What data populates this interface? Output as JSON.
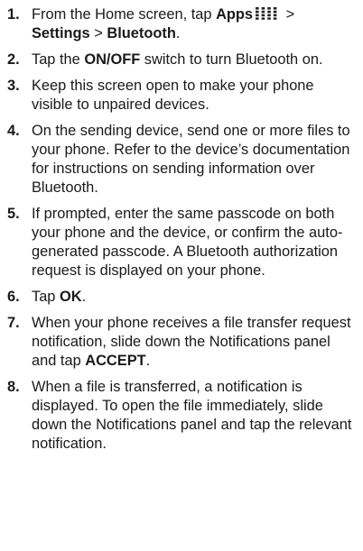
{
  "steps": [
    {
      "number": "1.",
      "parts": {
        "a": "From the Home screen, tap ",
        "apps": "Apps",
        "b": " > ",
        "settings": "Settings",
        "c": " > ",
        "bluetooth": "Bluetooth",
        "d": "."
      },
      "icon": "apps-grid-icon"
    },
    {
      "number": "2.",
      "parts": {
        "a": "Tap the ",
        "onoff": "ON/OFF",
        "b": " switch to turn Bluetooth on."
      }
    },
    {
      "number": "3.",
      "text": "Keep this screen open to make your phone visible to unpaired devices."
    },
    {
      "number": "4.",
      "text": "On the sending device, send one or more files to your phone. Refer to the device’s documentation for instructions on sending information over Bluetooth."
    },
    {
      "number": "5.",
      "text": "If prompted, enter the same passcode on both your phone and the device, or confirm the auto-generated passcode. A Bluetooth authorization request is displayed on your phone."
    },
    {
      "number": "6.",
      "parts": {
        "a": "Tap ",
        "ok": "OK",
        "b": "."
      }
    },
    {
      "number": "7.",
      "parts": {
        "a": "When your phone receives a file transfer request notification, slide down the Notifications panel and tap ",
        "accept": "ACCEPT",
        "b": "."
      }
    },
    {
      "number": "8.",
      "text": "When a file is transferred, a notification is displayed. To open the file immediately, slide down the Notifications panel and tap the relevant notification."
    }
  ]
}
